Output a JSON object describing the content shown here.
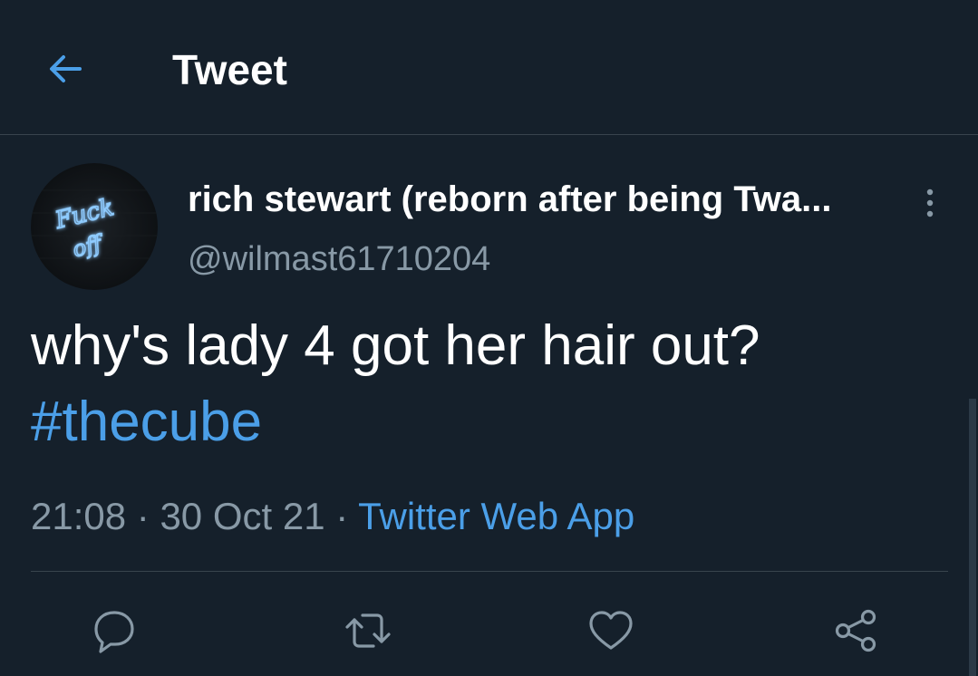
{
  "header": {
    "title": "Tweet",
    "back_icon": "arrow-left-icon"
  },
  "author": {
    "display_name": "rich stewart (reborn after being Twa...",
    "handle": "@wilmast61710204",
    "avatar_text": [
      "Fuck",
      "off"
    ]
  },
  "tweet": {
    "text": "why's lady 4 got her hair out?",
    "hashtag": "#thecube",
    "time": "21:08",
    "separator": "·",
    "date": "30 Oct 21",
    "source": "Twitter Web App"
  },
  "actions": [
    {
      "name": "reply",
      "icon": "comment-icon"
    },
    {
      "name": "retweet",
      "icon": "retweet-icon"
    },
    {
      "name": "like",
      "icon": "heart-icon"
    },
    {
      "name": "share",
      "icon": "share-icon"
    }
  ],
  "colors": {
    "background": "#15202b",
    "accent": "#4b9fe8",
    "secondary_text": "#8899a6",
    "divider": "#38444d"
  }
}
